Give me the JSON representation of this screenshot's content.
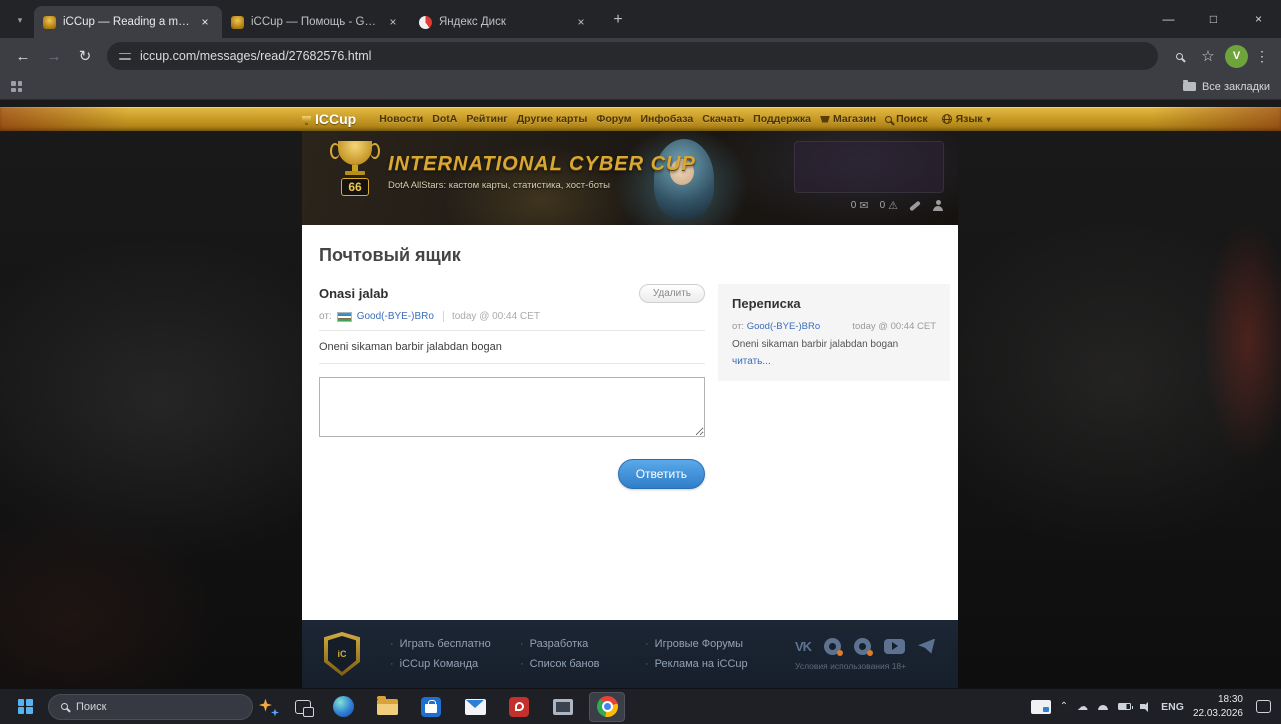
{
  "browser": {
    "tabs": [
      {
        "title": "iCCup — Reading a message fr"
      },
      {
        "title": "iCCup — Помощь - Good(-BYE"
      },
      {
        "title": "Яндекс Диск"
      }
    ],
    "url": "iccup.com/messages/read/27682576.html",
    "bookmarks_all_label": "Все закладки",
    "avatar_letter": "V"
  },
  "site": {
    "logo_text": "ICCup",
    "nav_items": [
      "Новости",
      "DotA",
      "Рейтинг",
      "Другие карты",
      "Форум",
      "Инфобаза",
      "Скачать",
      "Поддержка",
      "Магазин"
    ],
    "search_label": "Поиск",
    "language_label": "Язык",
    "banner": {
      "title": "INTERNATIONAL CYBER CUP",
      "subtitle": "DotA AllStars: кастом карты, статистика, хост-боты",
      "badge_number": "66",
      "mail_count": "0",
      "warning_count": "0"
    }
  },
  "mailbox": {
    "page_title": "Почтовый ящик",
    "subject": "Onasi jalab",
    "delete_label": "Удалить",
    "from_label": "от:",
    "sender": "Good(-BYE-)BRo",
    "timestamp": "today @ 00:44 CET",
    "body": "Oneni sikaman barbir jalabdan bogan",
    "reply_label": "Ответить"
  },
  "thread": {
    "title": "Переписка",
    "from_label": "от:",
    "sender": "Good(-BYE-)BRo",
    "timestamp": "today @ 00:44 CET",
    "preview": "Oneni sikaman barbir jalabdan bogan",
    "read_more": "читать..."
  },
  "footer": {
    "links": [
      "Играть бесплатно",
      "Разработка",
      "Игровые Форумы",
      "iCCup Команда",
      "Список банов",
      "Реклама на iCCup"
    ],
    "terms": "Условия использования 18+"
  },
  "taskbar": {
    "search_label": "Поиск",
    "language": "ENG",
    "time": "18:30",
    "date": "22.03.2026"
  }
}
